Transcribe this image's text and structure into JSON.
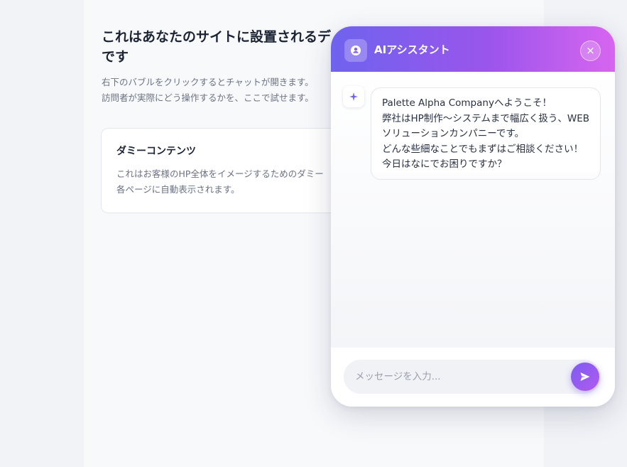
{
  "page": {
    "heading_line1": "これはあなたのサイトに設置されるデ",
    "heading_line2": "です",
    "desc_line1": "右下のバブルをクリックするとチャットが開きます。",
    "desc_line2": "訪問者が実際にどう操作するかを、ここで試せます。",
    "card": {
      "title": "ダミーコンテンツ",
      "body_line1": "これはお客様のHP全体をイメージするためのダミー",
      "body_line2": "各ページに自動表示されます。"
    }
  },
  "chat": {
    "title": "AIアシスタント",
    "avatar_icon": "user-circle-icon",
    "close_label": "×",
    "assistant_icon": "sparkle-icon",
    "message_lines": [
      "Palette Alpha Companyへようこそ！",
      "弊社はHP制作～システムまで幅広く扱う、WEB",
      "ソリューションカンパニーです。",
      "どんな些細なことでもまずはご相談ください！",
      "今日はなにでお困りですか？"
    ],
    "input_placeholder": "メッセージを入力...",
    "send_icon": "send-icon",
    "colors": {
      "header_start": "#6f63ee",
      "header_end": "#d765f0",
      "send_button": "#7c5cf2"
    }
  }
}
